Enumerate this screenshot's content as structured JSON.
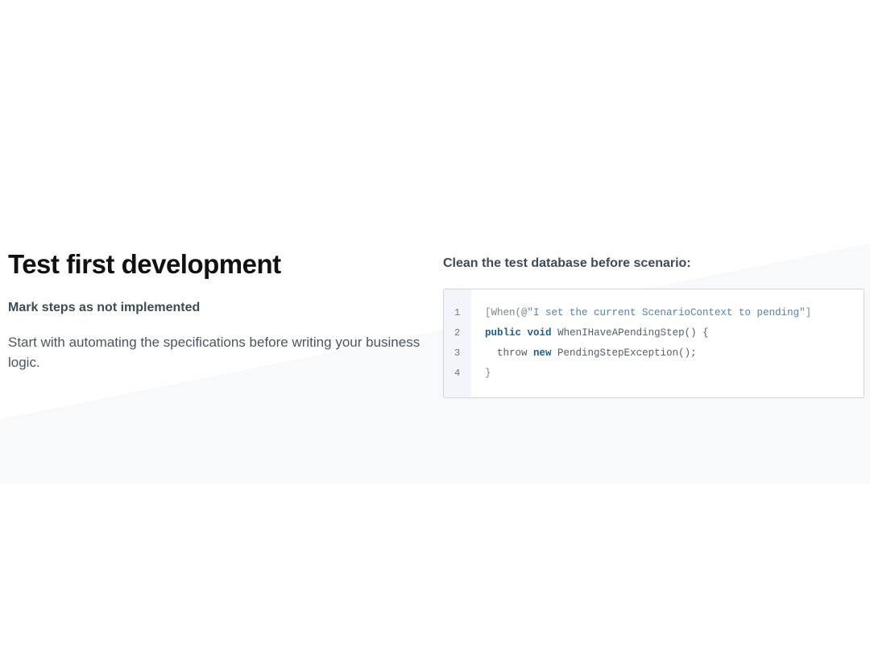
{
  "section": {
    "title": "Test first development",
    "subtitle": "Mark steps as not implemented",
    "description": "Start with automating the specifications before writing your business logic."
  },
  "code_panel": {
    "heading": "Clean the test database before scenario:",
    "line_numbers": [
      "1",
      "2",
      "3",
      "4"
    ],
    "lines": [
      {
        "indent": "",
        "p1": "[When(@",
        "str": "\"I set the current ScenarioContext to pending\"",
        "p2": "]"
      },
      {
        "indent": "",
        "kw1": "public",
        "kw2": "void",
        "rest": "WhenIHaveAPendingStep() {"
      },
      {
        "indent": "  ",
        "pre": "throw ",
        "kw": "new",
        "rest": " PendingStepException();"
      },
      {
        "indent": "",
        "text": "}"
      }
    ]
  },
  "colors": {
    "keyword": "#1d5f8a",
    "string": "#5b7ea8",
    "title": "#111111"
  }
}
